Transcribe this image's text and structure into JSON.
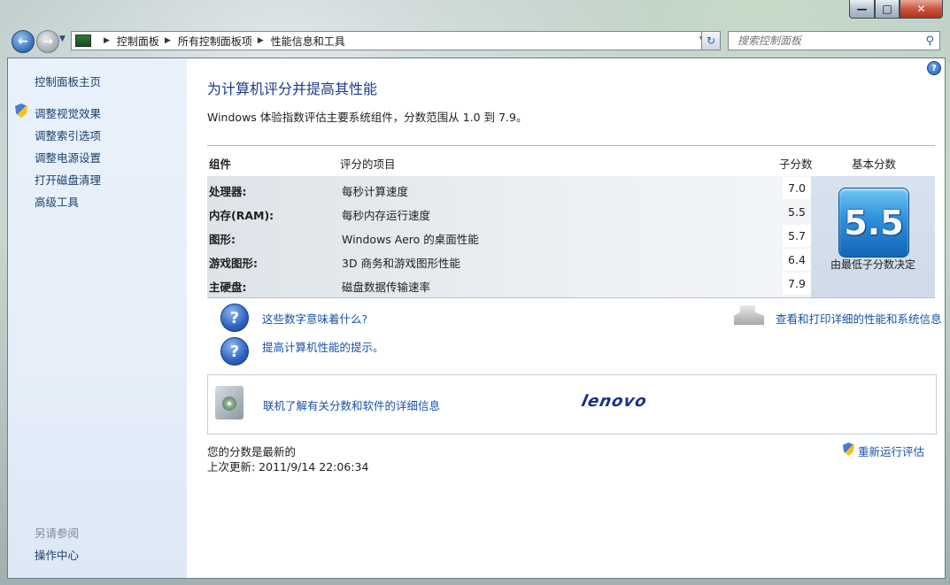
{
  "window": {
    "minimize_label": "—",
    "maximize_label": "□",
    "close_label": "✕"
  },
  "nav": {
    "back_glyph": "←",
    "forward_glyph": "→",
    "breadcrumbs": [
      "控制面板",
      "所有控制面板项",
      "性能信息和工具"
    ],
    "search_placeholder": "搜索控制面板",
    "refresh_glyph": "↻"
  },
  "sidebar": {
    "home": "控制面板主页",
    "items": [
      "调整视觉效果",
      "调整索引选项",
      "调整电源设置",
      "打开磁盘清理",
      "高级工具"
    ],
    "see_also": "另请参阅",
    "action_center": "操作中心"
  },
  "main": {
    "title": "为计算机评分并提高其性能",
    "description": "Windows 体验指数评估主要系统组件，分数范围从 1.0 到 7.9。",
    "headers": {
      "component": "组件",
      "rated_item": "评分的项目",
      "subscore": "子分数",
      "base_score": "基本分数"
    },
    "rows": [
      {
        "component": "处理器:",
        "item": "每秒计算速度",
        "subscore": "7.0"
      },
      {
        "component": "内存(RAM):",
        "item": "每秒内存运行速度",
        "subscore": "5.5"
      },
      {
        "component": "图形:",
        "item": "Windows Aero 的桌面性能",
        "subscore": "5.7"
      },
      {
        "component": "游戏图形:",
        "item": "3D 商务和游戏图形性能",
        "subscore": "6.4"
      },
      {
        "component": "主硬盘:",
        "item": "磁盘数据传输速率",
        "subscore": "7.9"
      }
    ],
    "base_score": "5.5",
    "base_caption": "由最低子分数决定",
    "links": {
      "what_numbers": "这些数字意味着什么?",
      "tips": "提高计算机性能的提示。",
      "print_details": "查看和打印详细的性能和系统信息",
      "online_info": "联机了解有关分数和软件的详细信息"
    },
    "lenovo_logo": "lenovo",
    "status": "您的分数是最新的",
    "last_update": "上次更新: 2011/9/14 22:06:34",
    "rerun": "重新运行评估"
  },
  "colors": {
    "link": "#1652a8",
    "title": "#1e3a8a",
    "sidebar_bg": "#e9f1fb"
  }
}
